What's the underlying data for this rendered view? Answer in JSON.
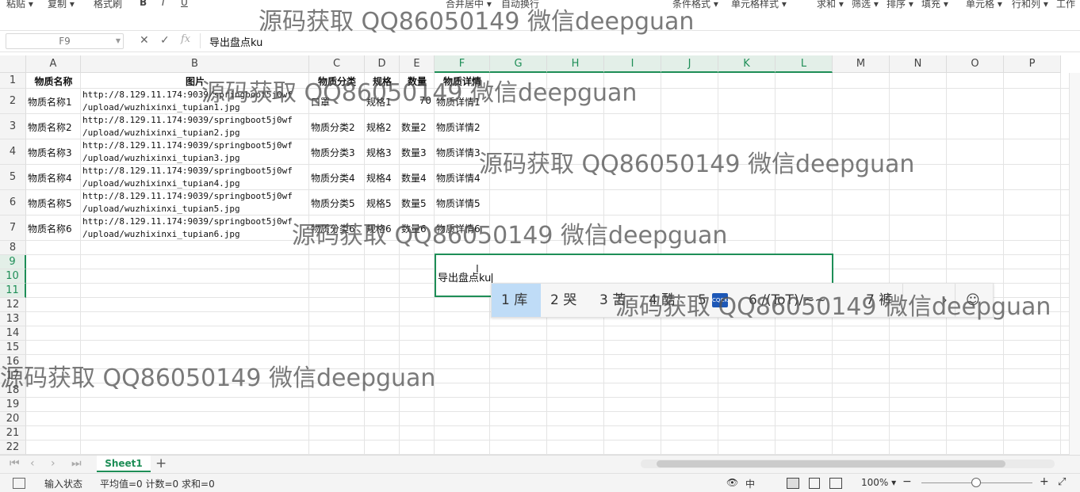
{
  "toolbar": {
    "paste": "粘贴 ▾",
    "copy": "复制 ▾",
    "format_painter": "格式刷",
    "bold": "B",
    "italic": "I",
    "underline": "U",
    "merge": "合并居中 ▾",
    "wrap": "自动换行",
    "cond_format": "条件格式 ▾",
    "cell_style": "单元格样式 ▾",
    "sum": "求和 ▾",
    "filter": "筛选 ▾",
    "sort": "排序 ▾",
    "fill": "填充 ▾",
    "cells": "单元格 ▾",
    "rows_cols": "行和列 ▾",
    "worksheet": "工作"
  },
  "formula_bar": {
    "name_box": "F9",
    "cancel": "✕",
    "confirm": "✓",
    "fx": "fx",
    "content": "导出盘点ku"
  },
  "columns": [
    "A",
    "B",
    "C",
    "D",
    "E",
    "F",
    "G",
    "H",
    "I",
    "J",
    "K",
    "L",
    "M",
    "N",
    "O",
    "P"
  ],
  "rows": [
    "1",
    "2",
    "3",
    "4",
    "5",
    "6",
    "7",
    "8",
    "9",
    "10",
    "11",
    "12",
    "13",
    "14",
    "15",
    "16",
    "17",
    "18",
    "19",
    "20",
    "21",
    "22"
  ],
  "header_row": [
    "物质名称",
    "图片",
    "物质分类",
    "规格",
    "数量",
    "物质详情"
  ],
  "data_rows": [
    {
      "name": "物质名称1",
      "url1": "http://8.129.11.174:9039/springboot5j0wf",
      "url2": "/upload/wuzhixinxi_tupian1.jpg",
      "cat": "口罩",
      "spec": "规格1",
      "qty": "70",
      "detail": "物质详情1"
    },
    {
      "name": "物质名称2",
      "url1": "http://8.129.11.174:9039/springboot5j0wf",
      "url2": "/upload/wuzhixinxi_tupian2.jpg",
      "cat": "物质分类2",
      "spec": "规格2",
      "qty": "数量2",
      "detail": "物质详情2"
    },
    {
      "name": "物质名称3",
      "url1": "http://8.129.11.174:9039/springboot5j0wf",
      "url2": "/upload/wuzhixinxi_tupian3.jpg",
      "cat": "物质分类3",
      "spec": "规格3",
      "qty": "数量3",
      "detail": "物质详情3"
    },
    {
      "name": "物质名称4",
      "url1": "http://8.129.11.174:9039/springboot5j0wf",
      "url2": "/upload/wuzhixinxi_tupian4.jpg",
      "cat": "物质分类4",
      "spec": "规格4",
      "qty": "数量4",
      "detail": "物质详情4"
    },
    {
      "name": "物质名称5",
      "url1": "http://8.129.11.174:9039/springboot5j0wf",
      "url2": "/upload/wuzhixinxi_tupian5.jpg",
      "cat": "物质分类5",
      "spec": "规格5",
      "qty": "数量5",
      "detail": "物质详情5"
    },
    {
      "name": "物质名称6",
      "url1": "http://8.129.11.174:9039/springboot5j0wf",
      "url2": "/upload/wuzhixinxi_tupian6.jpg",
      "cat": "物质分类6",
      "spec": "规格6",
      "qty": "数量6",
      "detail": "物质详情6"
    }
  ],
  "editing_cell": {
    "text": "导出盘点ku"
  },
  "ime": {
    "candidates": [
      "1 库",
      "2 哭",
      "3 苦",
      "4 酷",
      "5"
    ],
    "extra": "6 /(ToT)/~~",
    "seventh": "7 裤",
    "next": "›",
    "emoji": "☺"
  },
  "sheet_tabs": {
    "active": "Sheet1",
    "add": "+"
  },
  "status_bar": {
    "mode": "输入状态",
    "stats": "平均值=0  计数=0  求和=0",
    "zoom": "100% ▾",
    "minus": "−",
    "plus": "+"
  },
  "watermarks": [
    "源码获取 QQ86050149 微信deepguan",
    "源码获取 QQ86050149 微信deepguan",
    "源码获取 QQ86050149 微信deepguan",
    "源码获取 QQ86050149 微信deepguan",
    "源码获取 QQ86050149 微信deepguan",
    "源码获取 QQ86050149 微信deepguan"
  ],
  "colors": {
    "accent": "#1e8e57",
    "ime_highlight": "#bfdcf7"
  }
}
